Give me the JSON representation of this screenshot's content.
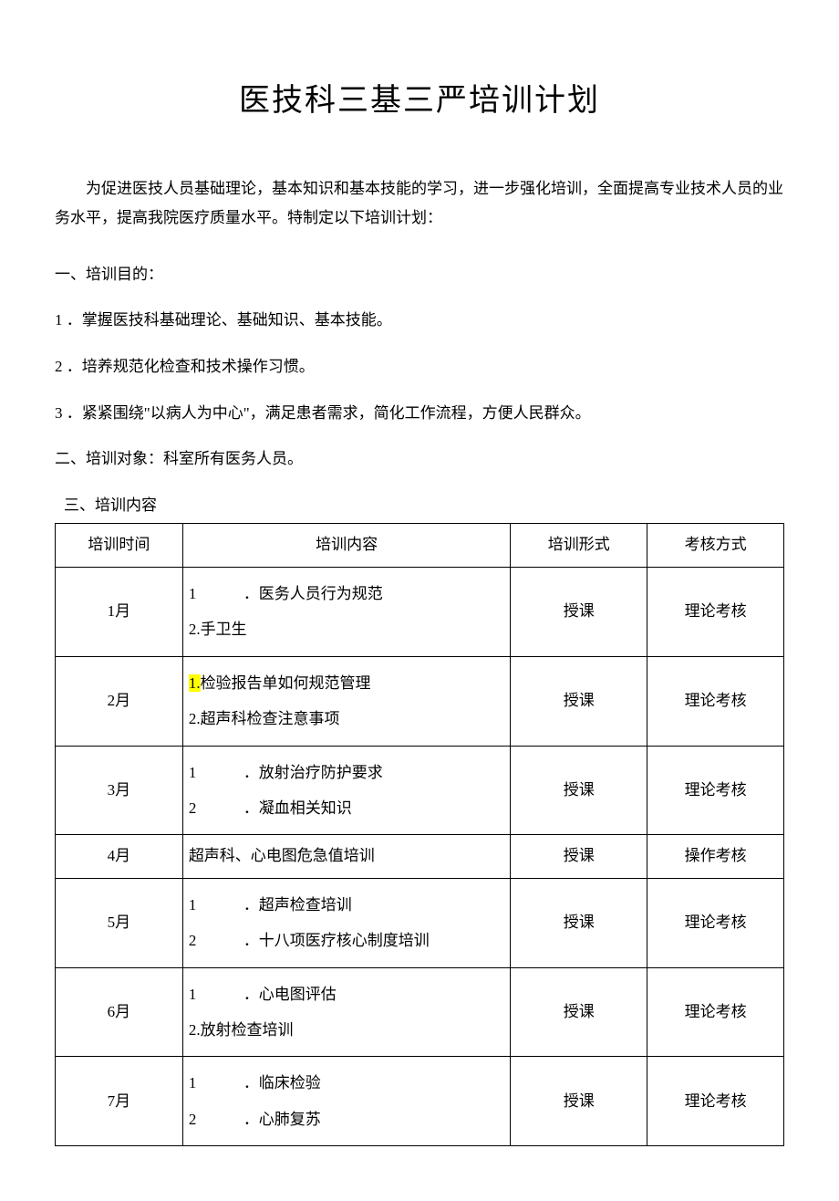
{
  "title": "医技科三基三严培训计划",
  "intro": "为促进医技人员基础理论，基本知识和基本技能的学习，进一步强化培训，全面提高专业技术人员的业务水平，提高我院医疗质量水平。特制定以下培训计划：",
  "section1": {
    "header": "一、培训目的：",
    "items": [
      "1 ．掌握医技科基础理论、基础知识、基本技能。",
      "2 ．培养规范化检查和技术操作习惯。",
      "3 ．紧紧围绕\"以病人为中心\"，满足患者需求，简化工作流程，方便人民群众。"
    ]
  },
  "section2": "二、培训对象：科室所有医务人员。",
  "section3": "三、培训内容",
  "table": {
    "headers": {
      "time": "培训时间",
      "content": "培训内容",
      "format": "培训形式",
      "exam": "考核方式"
    },
    "rows": [
      {
        "time": "1月",
        "content_lines": [
          {
            "num": "1",
            "wide": true,
            "text": "．医务人员行为规范"
          },
          {
            "num": "",
            "wide": false,
            "text": "2.手卫生"
          }
        ],
        "format": "授课",
        "exam": "理论考核"
      },
      {
        "time": "2月",
        "content_lines": [
          {
            "num": "1.",
            "wide": false,
            "highlight": true,
            "text": "检验报告单如何规范管理"
          },
          {
            "num": "",
            "wide": false,
            "text": "2.超声科检查注意事项"
          }
        ],
        "format": "授课",
        "exam": "理论考核"
      },
      {
        "time": "3月",
        "content_lines": [
          {
            "num": "1",
            "wide": true,
            "text": "．放射治疗防护要求"
          },
          {
            "num": "2",
            "wide": true,
            "text": "．凝血相关知识"
          }
        ],
        "format": "授课",
        "exam": "理论考核"
      },
      {
        "time": "4月",
        "single": true,
        "content_text": "超声科、心电图危急值培训",
        "format": "授课",
        "exam": "操作考核"
      },
      {
        "time": "5月",
        "content_lines": [
          {
            "num": "1",
            "wide": true,
            "text": "．超声检查培训"
          },
          {
            "num": "2",
            "wide": true,
            "text": "．十八项医疗核心制度培训"
          }
        ],
        "format": "授课",
        "exam": "理论考核"
      },
      {
        "time": "6月",
        "content_lines": [
          {
            "num": "1",
            "wide": true,
            "text": "．心电图评估"
          },
          {
            "num": "",
            "wide": false,
            "text": "2.放射检查培训"
          }
        ],
        "format": "授课",
        "exam": "理论考核"
      },
      {
        "time": "7月",
        "content_lines": [
          {
            "num": "1",
            "wide": true,
            "text": "．临床检验"
          },
          {
            "num": "2",
            "wide": true,
            "text": "．心肺复苏"
          }
        ],
        "format": "授课",
        "exam": "理论考核"
      }
    ]
  }
}
